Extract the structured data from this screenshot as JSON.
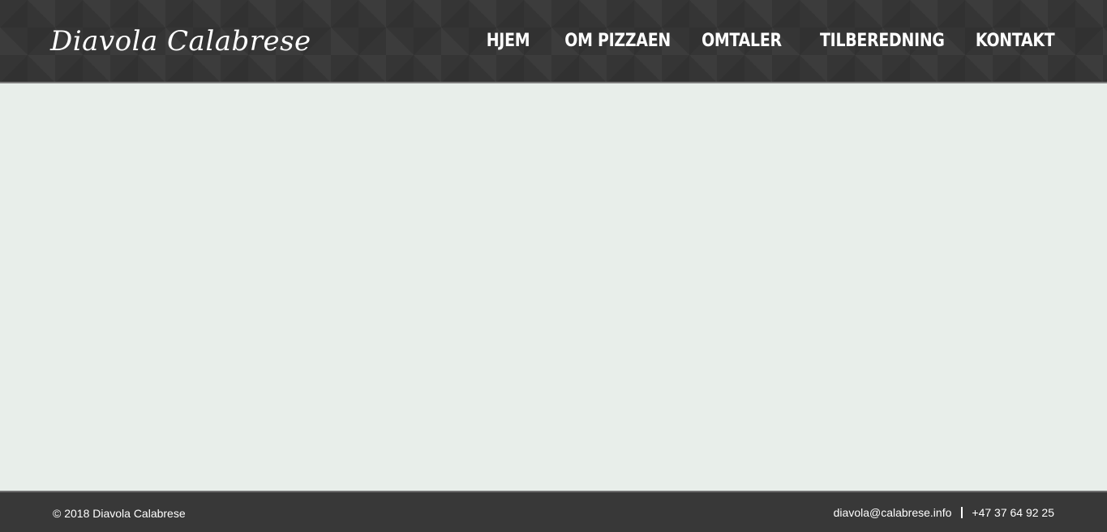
{
  "header": {
    "logo_text": "Diavola Calabrese",
    "nav": [
      {
        "label": "HJEM"
      },
      {
        "label": "OM PIZZAEN"
      },
      {
        "label": "OMTALER"
      },
      {
        "label": "TILBEREDNING"
      },
      {
        "label": "KONTAKT"
      }
    ]
  },
  "footer": {
    "copyright": "© 2018 Diavola Calabrese",
    "email": "diavola@calabrese.info",
    "phone": "+47 37 64 92 25"
  },
  "colors": {
    "header_background": "#353535",
    "content_background": "#e8eeea",
    "footer_background": "#383838",
    "text_light": "#ffffff"
  }
}
